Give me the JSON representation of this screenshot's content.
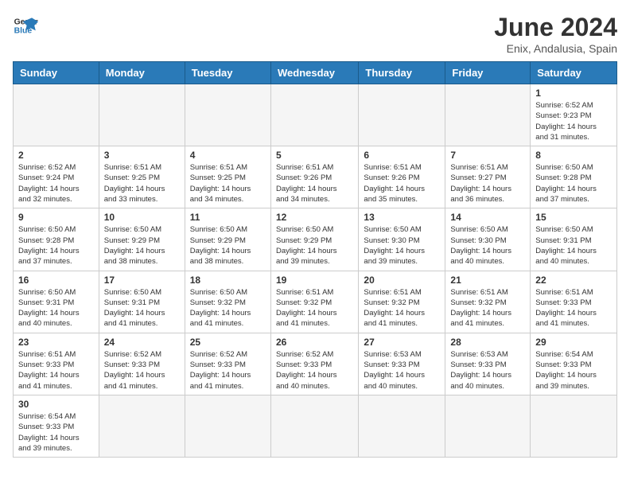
{
  "logo": {
    "general": "General",
    "blue": "Blue"
  },
  "header": {
    "month": "June 2024",
    "location": "Enix, Andalusia, Spain"
  },
  "weekdays": [
    "Sunday",
    "Monday",
    "Tuesday",
    "Wednesday",
    "Thursday",
    "Friday",
    "Saturday"
  ],
  "weeks": [
    [
      {
        "day": "",
        "info": ""
      },
      {
        "day": "",
        "info": ""
      },
      {
        "day": "",
        "info": ""
      },
      {
        "day": "",
        "info": ""
      },
      {
        "day": "",
        "info": ""
      },
      {
        "day": "",
        "info": ""
      },
      {
        "day": "1",
        "info": "Sunrise: 6:52 AM\nSunset: 9:23 PM\nDaylight: 14 hours\nand 31 minutes."
      }
    ],
    [
      {
        "day": "2",
        "info": "Sunrise: 6:52 AM\nSunset: 9:24 PM\nDaylight: 14 hours\nand 32 minutes."
      },
      {
        "day": "3",
        "info": "Sunrise: 6:51 AM\nSunset: 9:25 PM\nDaylight: 14 hours\nand 33 minutes."
      },
      {
        "day": "4",
        "info": "Sunrise: 6:51 AM\nSunset: 9:25 PM\nDaylight: 14 hours\nand 34 minutes."
      },
      {
        "day": "5",
        "info": "Sunrise: 6:51 AM\nSunset: 9:26 PM\nDaylight: 14 hours\nand 34 minutes."
      },
      {
        "day": "6",
        "info": "Sunrise: 6:51 AM\nSunset: 9:26 PM\nDaylight: 14 hours\nand 35 minutes."
      },
      {
        "day": "7",
        "info": "Sunrise: 6:51 AM\nSunset: 9:27 PM\nDaylight: 14 hours\nand 36 minutes."
      },
      {
        "day": "8",
        "info": "Sunrise: 6:50 AM\nSunset: 9:28 PM\nDaylight: 14 hours\nand 37 minutes."
      }
    ],
    [
      {
        "day": "9",
        "info": "Sunrise: 6:50 AM\nSunset: 9:28 PM\nDaylight: 14 hours\nand 37 minutes."
      },
      {
        "day": "10",
        "info": "Sunrise: 6:50 AM\nSunset: 9:29 PM\nDaylight: 14 hours\nand 38 minutes."
      },
      {
        "day": "11",
        "info": "Sunrise: 6:50 AM\nSunset: 9:29 PM\nDaylight: 14 hours\nand 38 minutes."
      },
      {
        "day": "12",
        "info": "Sunrise: 6:50 AM\nSunset: 9:29 PM\nDaylight: 14 hours\nand 39 minutes."
      },
      {
        "day": "13",
        "info": "Sunrise: 6:50 AM\nSunset: 9:30 PM\nDaylight: 14 hours\nand 39 minutes."
      },
      {
        "day": "14",
        "info": "Sunrise: 6:50 AM\nSunset: 9:30 PM\nDaylight: 14 hours\nand 40 minutes."
      },
      {
        "day": "15",
        "info": "Sunrise: 6:50 AM\nSunset: 9:31 PM\nDaylight: 14 hours\nand 40 minutes."
      }
    ],
    [
      {
        "day": "16",
        "info": "Sunrise: 6:50 AM\nSunset: 9:31 PM\nDaylight: 14 hours\nand 40 minutes."
      },
      {
        "day": "17",
        "info": "Sunrise: 6:50 AM\nSunset: 9:31 PM\nDaylight: 14 hours\nand 41 minutes."
      },
      {
        "day": "18",
        "info": "Sunrise: 6:50 AM\nSunset: 9:32 PM\nDaylight: 14 hours\nand 41 minutes."
      },
      {
        "day": "19",
        "info": "Sunrise: 6:51 AM\nSunset: 9:32 PM\nDaylight: 14 hours\nand 41 minutes."
      },
      {
        "day": "20",
        "info": "Sunrise: 6:51 AM\nSunset: 9:32 PM\nDaylight: 14 hours\nand 41 minutes."
      },
      {
        "day": "21",
        "info": "Sunrise: 6:51 AM\nSunset: 9:32 PM\nDaylight: 14 hours\nand 41 minutes."
      },
      {
        "day": "22",
        "info": "Sunrise: 6:51 AM\nSunset: 9:33 PM\nDaylight: 14 hours\nand 41 minutes."
      }
    ],
    [
      {
        "day": "23",
        "info": "Sunrise: 6:51 AM\nSunset: 9:33 PM\nDaylight: 14 hours\nand 41 minutes."
      },
      {
        "day": "24",
        "info": "Sunrise: 6:52 AM\nSunset: 9:33 PM\nDaylight: 14 hours\nand 41 minutes."
      },
      {
        "day": "25",
        "info": "Sunrise: 6:52 AM\nSunset: 9:33 PM\nDaylight: 14 hours\nand 41 minutes."
      },
      {
        "day": "26",
        "info": "Sunrise: 6:52 AM\nSunset: 9:33 PM\nDaylight: 14 hours\nand 40 minutes."
      },
      {
        "day": "27",
        "info": "Sunrise: 6:53 AM\nSunset: 9:33 PM\nDaylight: 14 hours\nand 40 minutes."
      },
      {
        "day": "28",
        "info": "Sunrise: 6:53 AM\nSunset: 9:33 PM\nDaylight: 14 hours\nand 40 minutes."
      },
      {
        "day": "29",
        "info": "Sunrise: 6:54 AM\nSunset: 9:33 PM\nDaylight: 14 hours\nand 39 minutes."
      }
    ],
    [
      {
        "day": "30",
        "info": "Sunrise: 6:54 AM\nSunset: 9:33 PM\nDaylight: 14 hours\nand 39 minutes."
      },
      {
        "day": "",
        "info": ""
      },
      {
        "day": "",
        "info": ""
      },
      {
        "day": "",
        "info": ""
      },
      {
        "day": "",
        "info": ""
      },
      {
        "day": "",
        "info": ""
      },
      {
        "day": "",
        "info": ""
      }
    ]
  ]
}
